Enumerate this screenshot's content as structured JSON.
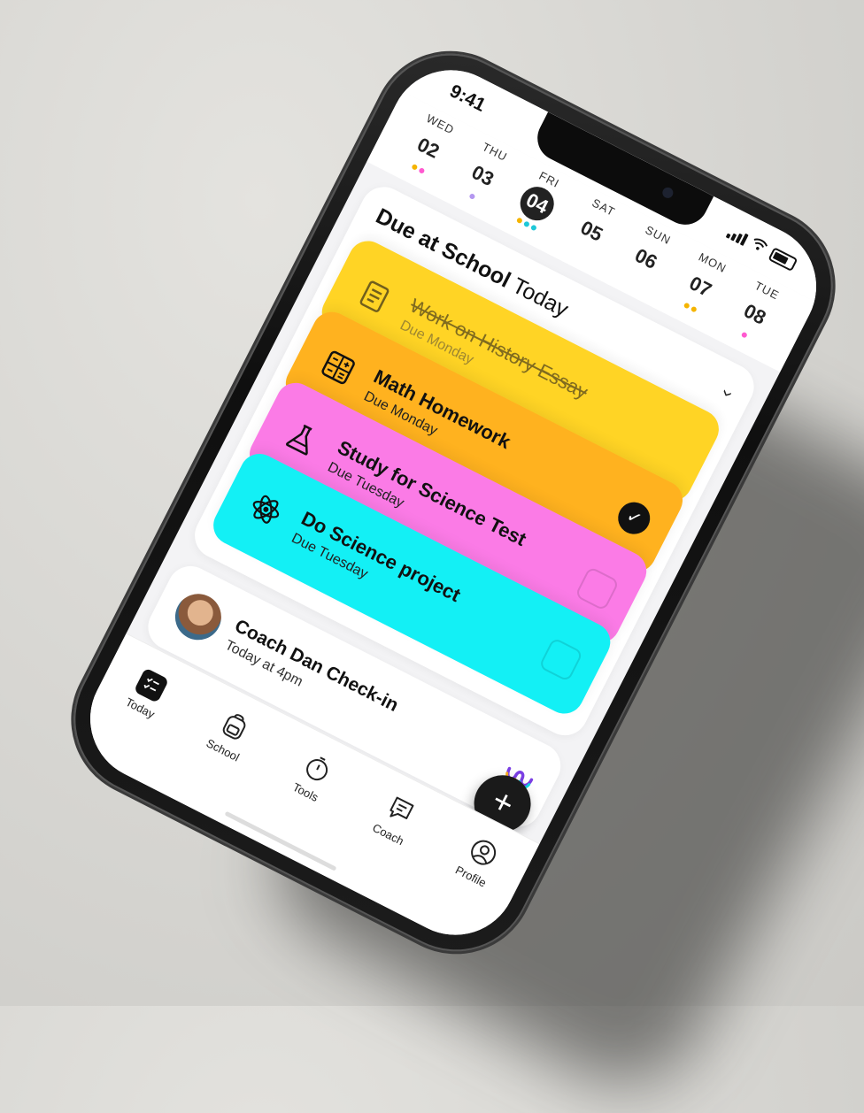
{
  "status": {
    "time": "9:41"
  },
  "week": [
    {
      "dow": "WED",
      "num": "02",
      "dots": [
        "#f5b400",
        "#ff5ad0"
      ]
    },
    {
      "dow": "THU",
      "num": "03",
      "dots": [
        "#b497f0"
      ]
    },
    {
      "dow": "FRI",
      "num": "04",
      "selected": true,
      "dots": [
        "#f5b400",
        "#1ec8d8",
        "#1ec8d8"
      ]
    },
    {
      "dow": "SAT",
      "num": "05",
      "dots": []
    },
    {
      "dow": "SUN",
      "num": "06",
      "dots": []
    },
    {
      "dow": "MON",
      "num": "07",
      "dots": [
        "#f5b400",
        "#f5b400"
      ]
    },
    {
      "dow": "TUE",
      "num": "08",
      "dots": [
        "#ff5ad0"
      ]
    }
  ],
  "card": {
    "title_bold": "Due at School",
    "title_rest": "Today"
  },
  "tasks": [
    {
      "title": "Work on History Essay",
      "due": "Due Monday",
      "color": "#ffd21a",
      "done": true,
      "icon": "scroll-icon"
    },
    {
      "title": "Math Homework",
      "due": "Due Monday",
      "color": "#ffb21f",
      "checked": true,
      "icon": "calculator-icon"
    },
    {
      "title": "Study for Science Test",
      "due": "Due Tuesday",
      "color": "#fb7be6",
      "checked": false,
      "icon": "flask-icon"
    },
    {
      "title": "Do Science project",
      "due": "Due Tuesday",
      "color": "#13f0f5",
      "checked": false,
      "icon": "atom-icon"
    }
  ],
  "coach": {
    "title": "Coach Dan Check-in",
    "time": "Today at 4pm"
  },
  "tabs": [
    {
      "label": "Today",
      "icon": "checklist-icon",
      "active": true
    },
    {
      "label": "School",
      "icon": "backpack-icon"
    },
    {
      "label": "Tools",
      "icon": "timer-icon"
    },
    {
      "label": "Coach",
      "icon": "chat-icon"
    },
    {
      "label": "Profile",
      "icon": "profile-icon"
    }
  ],
  "fab": {
    "label": "+"
  }
}
